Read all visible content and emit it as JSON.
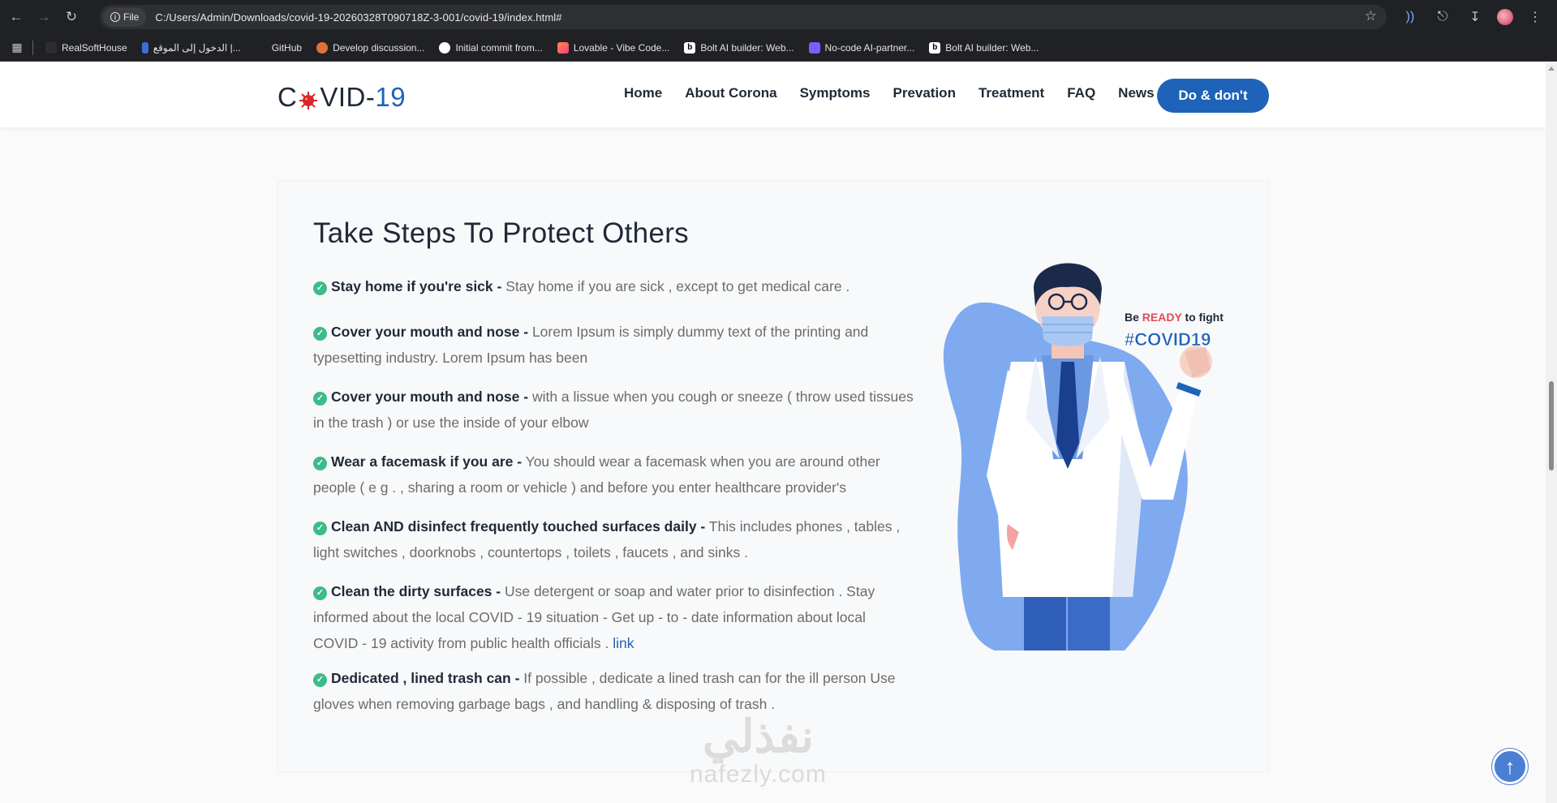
{
  "browser": {
    "file_chip": "File",
    "url": "C:/Users/Admin/Downloads/covid-19-20260328T090718Z-3-001/covid-19/index.html#",
    "bookmarks": [
      {
        "label": "RealSoftHouse",
        "color": "#2d2d2d"
      },
      {
        "label": "الدخول إلى الموقع |...",
        "color": "#3b6fd9"
      },
      {
        "label": "GitHub",
        "color": "#202124"
      },
      {
        "label": "Develop discussion...",
        "color": "#e0713a"
      },
      {
        "label": "Initial commit from...",
        "color": "#ffffff"
      },
      {
        "label": "Lovable - Vibe Code...",
        "color": "#ff5a7a"
      },
      {
        "label": "Bolt AI builder: Web...",
        "color": "#111111"
      },
      {
        "label": "No-code AI-partner...",
        "color": "#7b5cff"
      },
      {
        "label": "Bolt AI builder: Web...",
        "color": "#111111"
      }
    ]
  },
  "site": {
    "logo_text": "C",
    "logo_text_2": "VID-",
    "logo_num": "19",
    "menu": [
      "Home",
      "About Corona",
      "Symptoms",
      "Prevation",
      "Treatment",
      "FAQ",
      "News"
    ],
    "cta": "Do & don't"
  },
  "section": {
    "heading": "Take Steps To Protect Others",
    "items": [
      {
        "title": "Stay home if you're sick -",
        "text": " Stay home if you are sick , except to get medical care ."
      },
      {
        "title": "Cover your mouth and nose -",
        "text": " Lorem Ipsum is simply dummy text of the printing and typesetting industry. Lorem Ipsum has been"
      },
      {
        "title": "Cover your mouth and nose -",
        "text": " with a lissue when you cough or sneeze ( throw used tissues in the trash ) or use the inside of your elbow"
      },
      {
        "title": "Wear a facemask if you are -",
        "text": " You should wear a facemask when you are around other people ( e g . , sharing a room or vehicle ) and before you enter healthcare provider's"
      },
      {
        "title": "Clean AND disinfect frequently touched surfaces daily -",
        "text": " This includes phones , tables , light switches , doorknobs , countertops , toilets , faucets , and sinks ."
      },
      {
        "title": "Clean the dirty surfaces -",
        "text": " Use detergent or soap and water prior to disinfection . Stay informed about the local COVID - 19 situation - Get up - to - date information about local COVID - 19 activity from public health officials . ",
        "link": "link"
      },
      {
        "title": "Dedicated , lined trash can -",
        "text": " If possible , dedicate a lined trash can for the ill person Use gloves when removing garbage bags , and handling & disposing of trash ."
      }
    ],
    "illustration": {
      "be": "Be ",
      "ready": "READY",
      "to_fight": " to fight",
      "hashtag": "#COVID19"
    }
  },
  "watermark": {
    "arabic": "نفذلي",
    "latin": "nafezly.com"
  },
  "colors": {
    "brand_blue": "#1e63b8",
    "check_green": "#3dbb8a",
    "ready_red": "#e14b5a"
  }
}
